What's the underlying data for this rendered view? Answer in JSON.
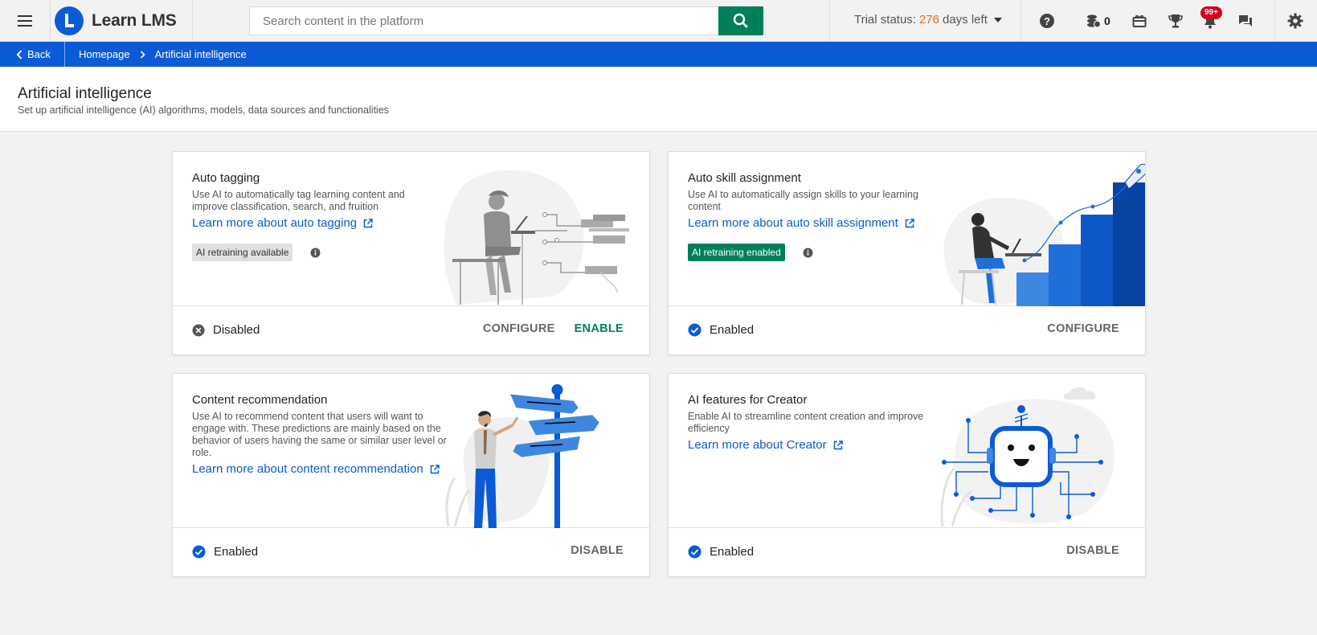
{
  "header": {
    "menu_icon": "hamburger-icon",
    "app_name": "Learn LMS",
    "search_placeholder": "Search content in the platform",
    "trial_label": "Trial status:",
    "trial_days": "276",
    "trial_suffix": "days left",
    "coins_count": "0",
    "notifications_badge": "99+",
    "accent": "#0a5bd5",
    "green": "#00805a"
  },
  "breadcrumb": {
    "back_label": "Back",
    "items": [
      "Homepage",
      "Artificial intelligence"
    ]
  },
  "page": {
    "title": "Artificial intelligence",
    "subtitle": "Set up artificial intelligence (AI) algorithms, models, data sources and functionalities"
  },
  "cards": [
    {
      "title": "Auto tagging",
      "description": "Use AI to automatically tag learning content and improve classification, search, and fruition",
      "link": "Learn more about auto tagging",
      "pill": "AI retraining available",
      "status": "Disabled",
      "actions": [
        "CONFIGURE",
        "ENABLE"
      ]
    },
    {
      "title": "Auto skill assignment",
      "description": "Use AI to automatically assign skills to your learning content",
      "link": "Learn more about auto skill assignment",
      "pill": "AI retraining enabled",
      "status": "Enabled",
      "actions": [
        "CONFIGURE"
      ]
    },
    {
      "title": "Content recommendation",
      "description": "Use AI to recommend content that users will want to engage with. These predictions are mainly based on the behavior of users having the same or similar user level or role.",
      "link": "Learn more about content recommendation",
      "status": "Enabled",
      "actions": [
        "DISABLE"
      ]
    },
    {
      "title": "AI features for Creator",
      "description": "Enable AI to streamline content creation and improve efficiency",
      "link": "Learn more about Creator",
      "status": "Enabled",
      "actions": [
        "DISABLE"
      ]
    }
  ]
}
